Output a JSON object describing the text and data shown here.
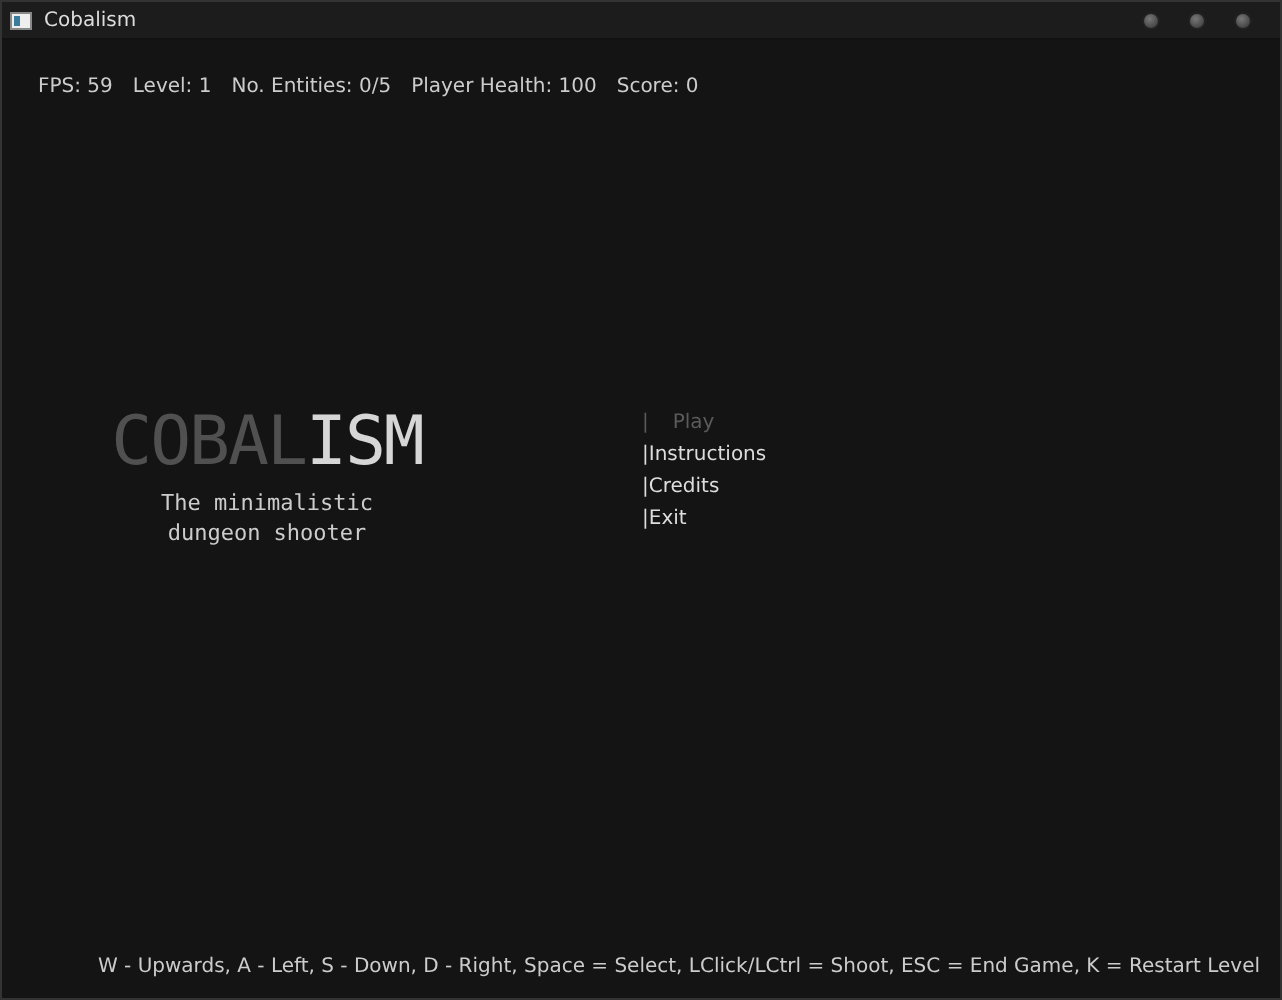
{
  "window": {
    "title": "Cobalism"
  },
  "hud": [
    "FPS: 59",
    "Level: 1",
    "No. Entities: 0/5",
    "Player Health: 100",
    "Score: 0"
  ],
  "logo": {
    "dim_part": "COBAL",
    "bright_part": "ISM",
    "tagline": [
      "The minimalistic",
      "dungeon shooter"
    ]
  },
  "menu": [
    {
      "marker": "|",
      "label": "Play",
      "selected": true
    },
    {
      "marker": "|",
      "label": "Instructions",
      "selected": false
    },
    {
      "marker": "|",
      "label": "Credits",
      "selected": false
    },
    {
      "marker": "|",
      "label": "Exit",
      "selected": false
    }
  ],
  "controls_help": "W - Upwards, A - Left, S - Down, D - Right, Space = Select, LClick/LCtrl = Shoot, ESC = End Game, K = Restart Level"
}
